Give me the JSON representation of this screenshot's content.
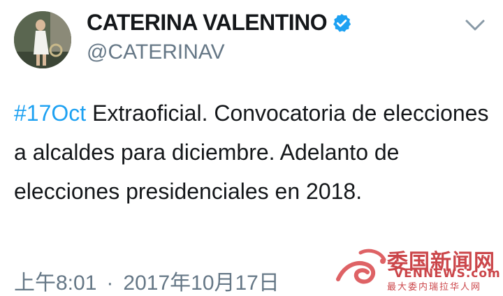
{
  "tweet": {
    "author": {
      "display_name": "CATERINA VALENTINO",
      "handle": "@CATERINAV",
      "verified": true,
      "avatar_icon": "profile-photo"
    },
    "menu_icon": "chevron-down-icon",
    "hashtag": "#17Oct",
    "body": " Extraoficial. Convocatoria de elecciones a alcaldes para diciembre. Adelanto de elecciones presidenciales en 2018.",
    "time": "上午8:01",
    "separator": "·",
    "date": "2017年10月17日"
  },
  "watermark": {
    "name_cn": "委国新闻网",
    "name_en": "VENNEWS.com",
    "tagline": "最大委内瑞拉华人网",
    "color": "#c3262b"
  },
  "colors": {
    "hashtag": "#1da1f2",
    "secondary_text": "#657786",
    "verified_badge": "#1da1f2"
  }
}
